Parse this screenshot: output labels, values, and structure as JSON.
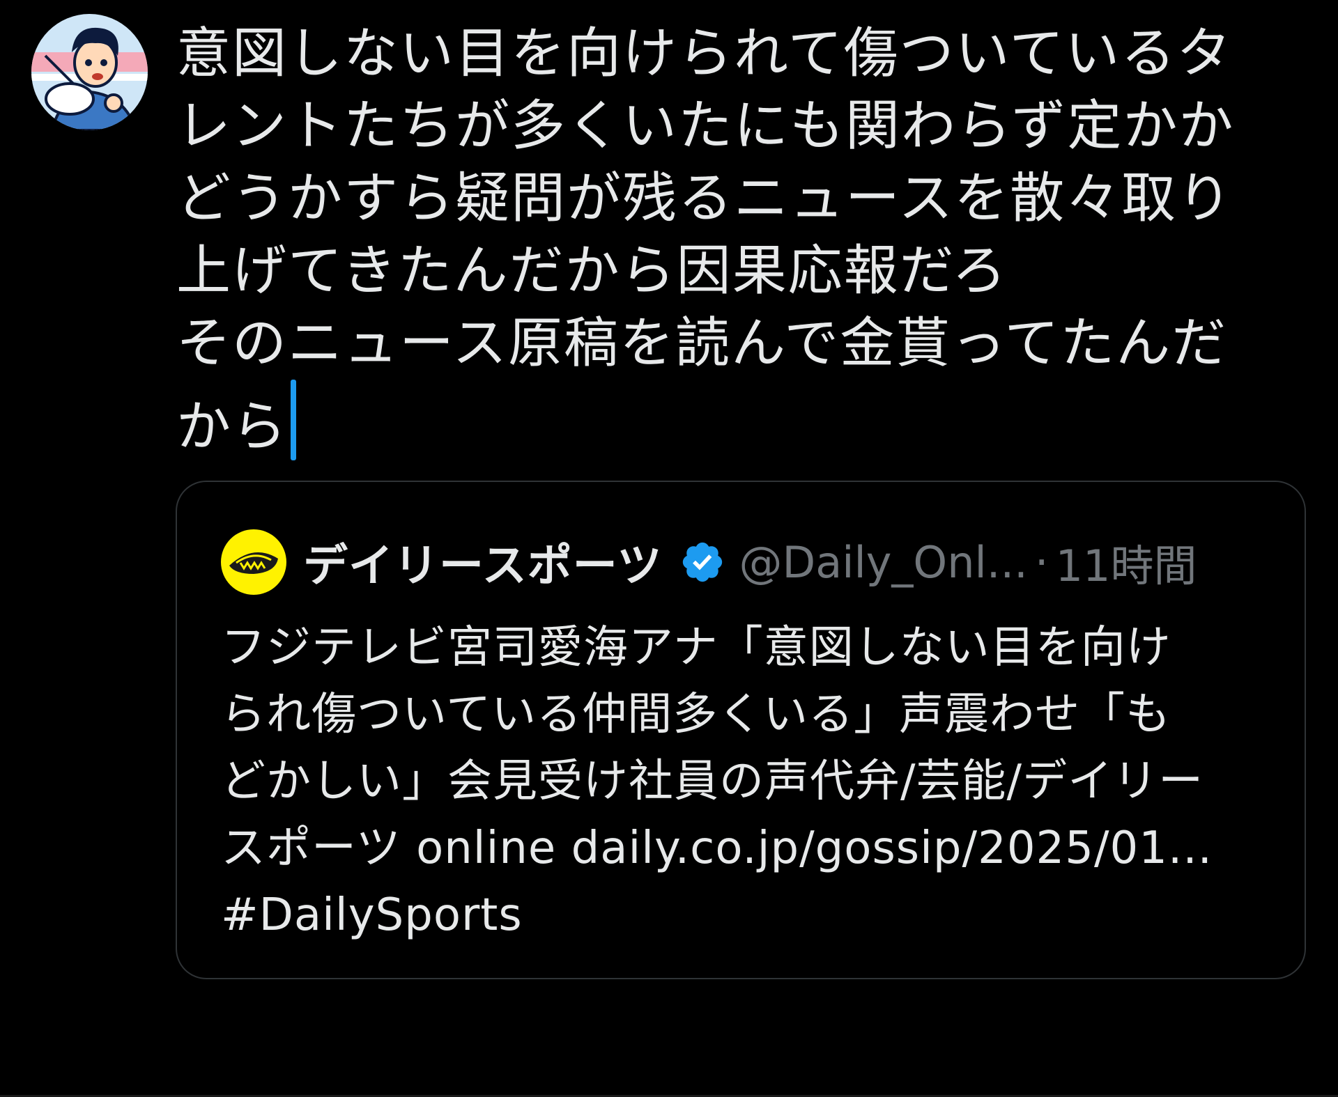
{
  "composer": {
    "author_avatar_icon": "user-avatar-illustration",
    "text": "意図しない目を向けられて傷ついているタ\nレントたちが多くいたにも関わらず定かか\nどうかすら疑問が残るニュースを散々取り\n上げてきたんだから因果応報だろ\nそのニュース原稿を読んで金貰ってたんだ\nから"
  },
  "quote": {
    "avatar_icon": "daily-sports-logo",
    "name": "デイリースポーツ",
    "verified_icon": "verified-badge-icon",
    "handle": "@Daily_Onl...",
    "dot": "·",
    "time": "11時間",
    "body": "フジテレビ宮司愛海アナ「意図しない目を向け\nられ傷ついている仲間多くいる」声震わせ「も\nどかしい」会見受け社員の声代弁/芸能/デイリー\nスポーツ online daily.co.jp/gossip/2025/01...\n#DailySports"
  },
  "colors": {
    "background": "#000000",
    "text": "#e7e9ea",
    "muted": "#71767b",
    "accent": "#1d9bf0",
    "border": "#2f3336",
    "logo_yellow": "#fff200"
  }
}
